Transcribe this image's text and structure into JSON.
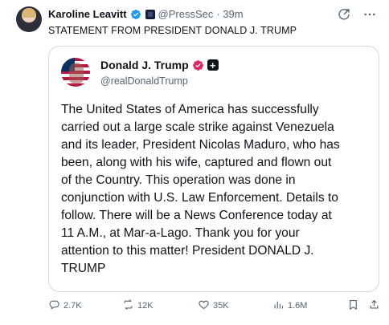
{
  "author": {
    "name": "Karoline Leavitt",
    "handle": "@PressSec",
    "time": "· 39m"
  },
  "statement": "STATEMENT FROM PRESIDENT DONALD J. TRUMP",
  "quoted": {
    "name": "Donald J. Trump",
    "handle": "@realDonaldTrump",
    "body": "The United States of America has successfully\ncarried out a large scale strike against Venezuela\nand its leader, President Nicolas Maduro, who has\nbeen, along with his wife, captured and flown out\nof the Country. This operation was done in\nconjunction with U.S. Law Enforcement. Details to\nfollow. There will be a News Conference today at\n11 A.M., at Mar-a-Lago. Thank you for your\nattention to this matter! President DONALD J.\nTRUMP"
  },
  "stats": {
    "replies": "2.7K",
    "reposts": "12K",
    "likes": "35K",
    "views": "1.6M"
  },
  "icons": {
    "verified": "verified-badge-icon",
    "grok": "grok-icon",
    "more": "more-icon",
    "reply": "reply-icon",
    "repost": "repost-icon",
    "like": "heart-icon",
    "views": "views-icon",
    "bookmark": "bookmark-icon",
    "share": "share-icon"
  },
  "colors": {
    "verified": "#1d9bf0",
    "quoted_verified": "#e0245e",
    "text": "#0f1419",
    "muted": "#536471",
    "border": "#cfd9de"
  }
}
